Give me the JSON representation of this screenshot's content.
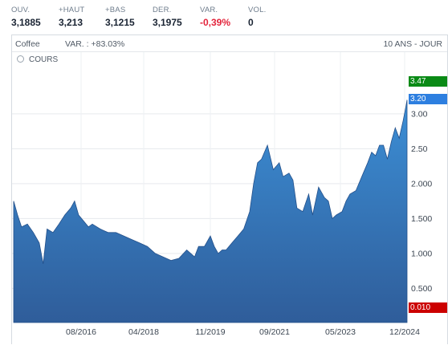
{
  "quote_bar": [
    {
      "label": "OUV.",
      "value": "3,1885"
    },
    {
      "label": "+HAUT",
      "value": "3,213"
    },
    {
      "label": "+BAS",
      "value": "3,1215"
    },
    {
      "label": "DER.",
      "value": "3,1975"
    },
    {
      "label": "VAR.",
      "value": "-0,39%",
      "negative": true
    },
    {
      "label": "VOL.",
      "value": "0"
    }
  ],
  "header": {
    "instrument": "Coffee",
    "variation": "VAR. : +83.03%",
    "period": "10 ANS - JOUR"
  },
  "chart_controls": {
    "settings_icon": "gear-icon",
    "series_label": "COURS"
  },
  "price_tags": [
    {
      "label": "3.47",
      "color": "#0a8a16"
    },
    {
      "label": "3.20",
      "color": "#2d7fe0"
    },
    {
      "label": "0.010",
      "color": "#cc0000"
    }
  ],
  "chart_data": {
    "type": "area",
    "x_tick_labels": [
      "08/2016",
      "04/2018",
      "11/2019",
      "09/2021",
      "05/2023",
      "12/2024"
    ],
    "y_tick_labels": [
      "3.00",
      "2.50",
      "2.000",
      "1.500",
      "1.000",
      "0.500"
    ],
    "y_ticks": [
      3.0,
      2.5,
      2.0,
      1.5,
      1.0,
      0.5
    ],
    "ylim": [
      0.01,
      3.47
    ],
    "xlim": [
      2015.0,
      2025.0
    ],
    "series": [
      {
        "x": [
          2015.0,
          2015.1,
          2015.2,
          2015.35,
          2015.5,
          2015.65,
          2015.75,
          2015.85,
          2016.0,
          2016.15,
          2016.3,
          2016.45,
          2016.55,
          2016.65,
          2016.8,
          2016.9,
          2017.0,
          2017.2,
          2017.4,
          2017.6,
          2017.8,
          2018.0,
          2018.2,
          2018.4,
          2018.6,
          2018.8,
          2019.0,
          2019.2,
          2019.4,
          2019.6,
          2019.7,
          2019.85,
          2020.0,
          2020.1,
          2020.2,
          2020.3,
          2020.4,
          2020.55,
          2020.7,
          2020.85,
          2021.0,
          2021.1,
          2021.2,
          2021.3,
          2021.45,
          2021.6,
          2021.75,
          2021.85,
          2022.0,
          2022.1,
          2022.2,
          2022.35,
          2022.5,
          2022.6,
          2022.75,
          2022.9,
          2023.0,
          2023.1,
          2023.2,
          2023.35,
          2023.45,
          2023.55,
          2023.7,
          2023.85,
          2024.0,
          2024.1,
          2024.2,
          2024.3,
          2024.4,
          2024.5,
          2024.6,
          2024.7,
          2024.8,
          2024.9,
          2024.97,
          2025.0
        ],
        "y": [
          1.75,
          1.55,
          1.38,
          1.42,
          1.3,
          1.15,
          0.85,
          1.35,
          1.3,
          1.42,
          1.55,
          1.65,
          1.75,
          1.55,
          1.45,
          1.38,
          1.42,
          1.35,
          1.3,
          1.3,
          1.25,
          1.2,
          1.15,
          1.1,
          1.0,
          0.95,
          0.9,
          0.93,
          1.05,
          0.95,
          1.1,
          1.1,
          1.25,
          1.1,
          1.0,
          1.05,
          1.05,
          1.15,
          1.25,
          1.35,
          1.6,
          2.0,
          2.3,
          2.35,
          2.55,
          2.2,
          2.3,
          2.1,
          2.15,
          2.05,
          1.65,
          1.6,
          1.85,
          1.55,
          1.95,
          1.8,
          1.75,
          1.5,
          1.55,
          1.6,
          1.75,
          1.85,
          1.9,
          2.1,
          2.3,
          2.45,
          2.4,
          2.55,
          2.55,
          2.35,
          2.6,
          2.8,
          2.65,
          2.9,
          3.1,
          3.2
        ]
      }
    ]
  }
}
